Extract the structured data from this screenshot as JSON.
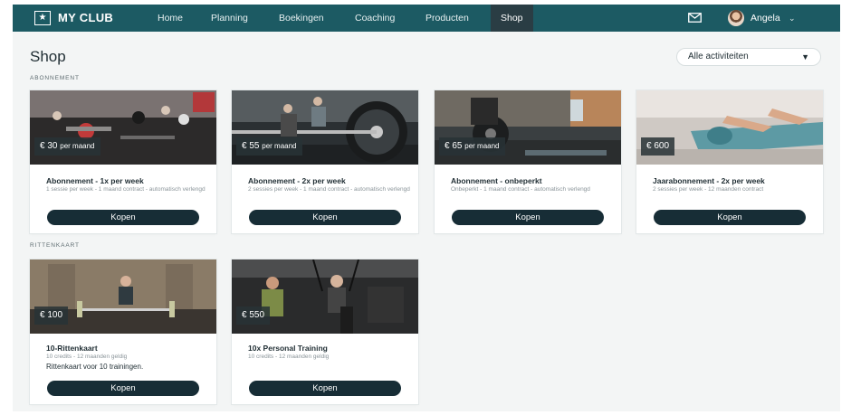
{
  "nav": {
    "brand": "MY CLUB",
    "items": [
      "Home",
      "Planning",
      "Boekingen",
      "Coaching",
      "Producten",
      "Shop"
    ],
    "active": "Shop",
    "user": "Angela",
    "icons": [
      "star-icon",
      "mail-icon",
      "chevron-down-icon"
    ]
  },
  "page": {
    "title": "Shop",
    "filter": "Alle activiteiten"
  },
  "sections": [
    {
      "label": "ABONNEMENT",
      "products": [
        {
          "price": "€ 30",
          "per": "per maand",
          "title": "Abonnement - 1x per week",
          "sub": "1 sessie per week - 1 maand contract - automatisch verlengd",
          "button": "Kopen"
        },
        {
          "price": "€ 55",
          "per": "per maand",
          "title": "Abonnement - 2x per week",
          "sub": "2 sessies per week - 1 maand contract - automatisch verlengd",
          "button": "Kopen"
        },
        {
          "price": "€ 65",
          "per": "per maand",
          "title": "Abonnement - onbeperkt",
          "sub": "Onbeperkt - 1 maand contract - automatisch verlengd",
          "button": "Kopen"
        },
        {
          "price": "€ 600",
          "per": "",
          "title": "Jaarabonnement - 2x per week",
          "sub": "2 sessies per week - 12 maanden contract",
          "button": "Kopen"
        }
      ]
    },
    {
      "label": "RITTENKAART",
      "products": [
        {
          "price": "€ 100",
          "per": "",
          "title": "10-Rittenkaart",
          "sub": "10 credits - 12 maanden geldig",
          "desc": "Rittenkaart voor 10 trainingen.",
          "button": "Kopen"
        },
        {
          "price": "€ 550",
          "per": "",
          "title": "10x Personal Training",
          "sub": "10 credits - 12 maanden geldig",
          "button": "Kopen"
        }
      ]
    }
  ],
  "colors": {
    "nav": "#1c5a63",
    "nav_active": "#2a3d44",
    "button": "#172d36",
    "background": "#f3f5f5"
  }
}
